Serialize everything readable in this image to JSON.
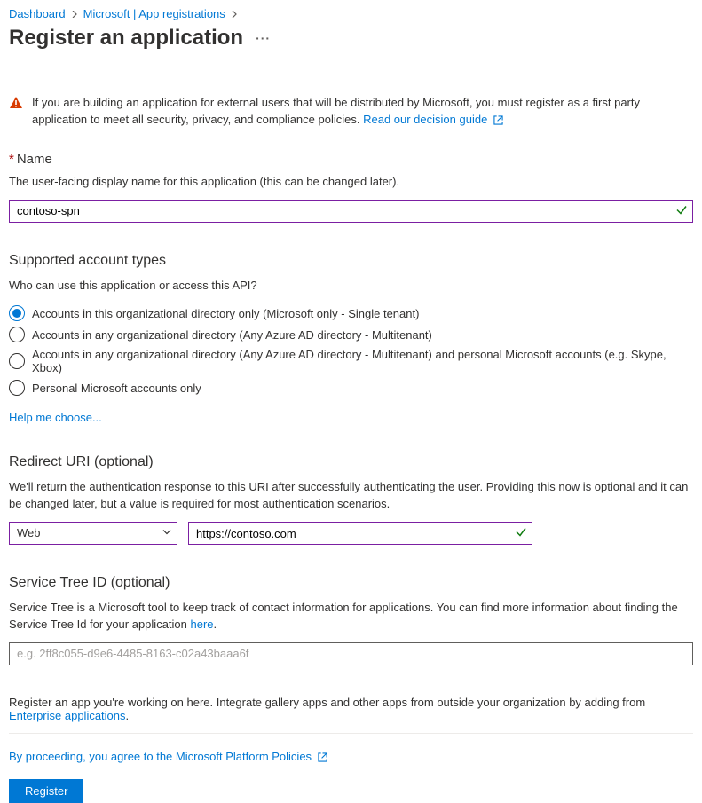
{
  "breadcrumb": {
    "items": [
      "Dashboard",
      "Microsoft | App registrations"
    ]
  },
  "title": "Register an application",
  "banner": {
    "text": "If you are building an application for external users that will be distributed by Microsoft, you must register as a first party application to meet all security, privacy, and compliance policies. ",
    "link": "Read our decision guide"
  },
  "name": {
    "label": "Name",
    "help": "The user-facing display name for this application (this can be changed later).",
    "value": "contoso-spn"
  },
  "accountTypes": {
    "heading": "Supported account types",
    "subtext": "Who can use this application or access this API?",
    "options": [
      "Accounts in this organizational directory only (Microsoft only - Single tenant)",
      "Accounts in any organizational directory (Any Azure AD directory - Multitenant)",
      "Accounts in any organizational directory (Any Azure AD directory - Multitenant) and personal Microsoft accounts (e.g. Skype, Xbox)",
      "Personal Microsoft accounts only"
    ],
    "selected": 0,
    "helpLink": "Help me choose..."
  },
  "redirect": {
    "heading": "Redirect URI (optional)",
    "help": "We'll return the authentication response to this URI after successfully authenticating the user. Providing this now is optional and it can be changed later, but a value is required for most authentication scenarios.",
    "platform": "Web",
    "uri": "https://contoso.com"
  },
  "serviceTree": {
    "heading": "Service Tree ID (optional)",
    "helpPrefix": "Service Tree is a Microsoft tool to keep track of contact information for applications. You can find more information about finding the Service Tree Id for your application ",
    "helpLink": "here",
    "helpSuffix": ".",
    "placeholder": "e.g. 2ff8c055-d9e6-4485-8163-c02a43baaa6f"
  },
  "footer": {
    "note": "Register an app you're working on here. Integrate gallery apps and other apps from outside your organization by adding from ",
    "noteLink": "Enterprise applications",
    "noteSuffix": ".",
    "agree": "By proceeding, you agree to the Microsoft Platform Policies",
    "button": "Register"
  }
}
